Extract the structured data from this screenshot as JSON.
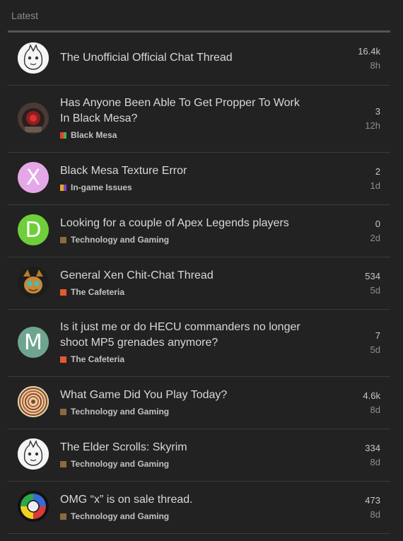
{
  "header": {
    "title": "Latest"
  },
  "topics": [
    {
      "title": "The Unofficial Official Chat Thread",
      "category": null,
      "replies": "16.4k",
      "age": "8h",
      "avatar": "sketch-avatar-1"
    },
    {
      "title": "Has Anyone Been Able To Get Propper To Work In Black Mesa?",
      "category": "Black Mesa",
      "category_colors": [
        "#e2432b",
        "#49b050"
      ],
      "replies": "3",
      "age": "12h",
      "avatar": "robot-avatar"
    },
    {
      "title": "Black Mesa Texture Error",
      "category": "In-game Issues",
      "category_colors": [
        "#e6a823",
        "#8a3fbf"
      ],
      "replies": "2",
      "age": "1d",
      "avatar_letter": "X",
      "avatar_color": "#e4a8e8"
    },
    {
      "title": "Looking for a couple of Apex Legends players",
      "category": "Technology and Gaming",
      "category_colors": [
        "#8b6a3e"
      ],
      "replies": "0",
      "age": "2d",
      "avatar_letter": "D",
      "avatar_color": "#6fcf3a"
    },
    {
      "title": "General Xen Chit-Chat Thread",
      "category": "The Cafeteria",
      "category_colors": [
        "#e8582f"
      ],
      "replies": "534",
      "age": "5d",
      "avatar": "creature-avatar"
    },
    {
      "title": "Is it just me or do HECU commanders no longer shoot MP5 grenades anymore?",
      "category": "The Cafeteria",
      "category_colors": [
        "#e8582f"
      ],
      "replies": "7",
      "age": "5d",
      "avatar_letter": "M",
      "avatar_color": "#6fa58f"
    },
    {
      "title": "What Game Did You Play Today?",
      "category": "Technology and Gaming",
      "category_colors": [
        "#8b6a3e"
      ],
      "replies": "4.6k",
      "age": "8d",
      "avatar": "rings-avatar"
    },
    {
      "title": "The Elder Scrolls: Skyrim",
      "category": "Technology and Gaming",
      "category_colors": [
        "#8b6a3e"
      ],
      "replies": "334",
      "age": "8d",
      "avatar": "sketch-avatar-2"
    },
    {
      "title": "OMG “x” is on sale thread.",
      "category": "Technology and Gaming",
      "category_colors": [
        "#8b6a3e"
      ],
      "replies": "473",
      "age": "8d",
      "avatar": "simon-avatar"
    }
  ]
}
